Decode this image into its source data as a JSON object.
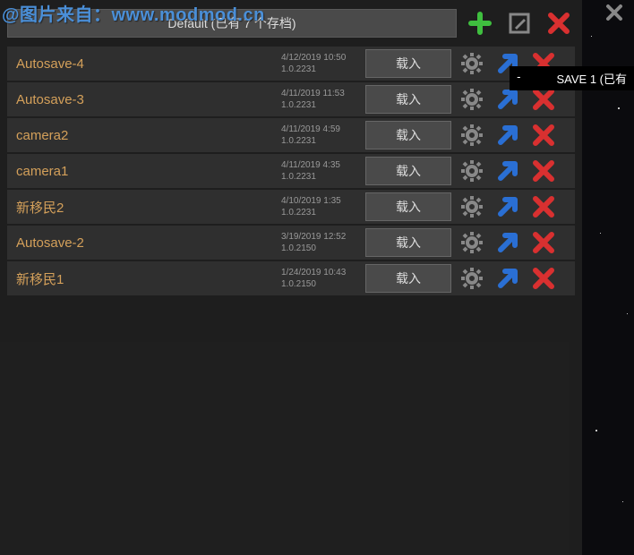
{
  "watermark": "@图片来自：www.modmod.cn",
  "profile_label": "Default (已有 7 个存档)",
  "header": {
    "add_icon": "add",
    "rename_icon": "rename",
    "delete_icon": "delete"
  },
  "load_label": "载入",
  "tooltip": {
    "left": "-",
    "right": "SAVE 1 (已有"
  },
  "saves": [
    {
      "name": "Autosave-4",
      "date": "4/12/2019 10:50",
      "version": "1.0.2231"
    },
    {
      "name": "Autosave-3",
      "date": "4/11/2019 11:53",
      "version": "1.0.2231"
    },
    {
      "name": "camera2",
      "date": "4/11/2019 4:59",
      "version": "1.0.2231"
    },
    {
      "name": "camera1",
      "date": "4/11/2019 4:35",
      "version": "1.0.2231"
    },
    {
      "name": "新移民2",
      "date": "4/10/2019 1:35",
      "version": "1.0.2231"
    },
    {
      "name": "Autosave-2",
      "date": "3/19/2019 12:52",
      "version": "1.0.2150"
    },
    {
      "name": "新移民1",
      "date": "1/24/2019 10:43",
      "version": "1.0.2150"
    }
  ]
}
